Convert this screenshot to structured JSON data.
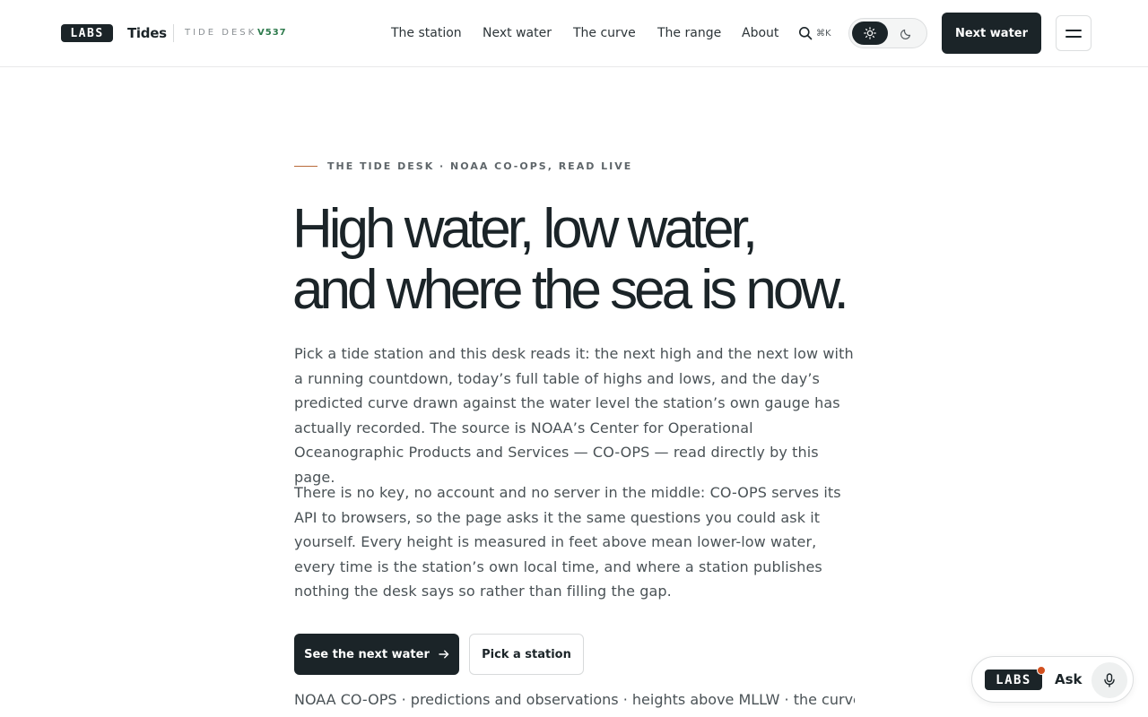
{
  "header": {
    "logo": "LABS",
    "brand": "Tides",
    "desk_label": "TIDE DESK",
    "version": "V537",
    "nav": [
      "The station",
      "Next water",
      "The curve",
      "The range",
      "About"
    ],
    "search_shortcut": "⌘K",
    "cta": "Next water"
  },
  "hero": {
    "eyebrow": "THE TIDE DESK · NOAA CO-OPS, READ LIVE",
    "title_line1": "High water, low water,",
    "title_line2": "and where the sea is now.",
    "para1": "Pick a tide station and this desk reads it: the next high and the next low with a running countdown, today’s full table of highs and lows, and the day’s predicted curve drawn against the water level the station’s own gauge has actually recorded. The source is NOAA’s Center for Operational Oceanographic Products and Services — CO-OPS — read directly by this page.",
    "para2": "There is no key, no account and no server in the middle: CO-OPS serves its API to browsers, so the page asks it the same questions you could ask it yourself. Every height is measured in feet above mean lower-low water, every time is the station’s own local time, and where a station publishes nothing the desk says so rather than filling the gap.",
    "primary_button": "See the next water",
    "secondary_button": "Pick a station",
    "footnote": "NOAA CO-OPS · predictions and observations · heights above MLLW · the curve"
  },
  "ask_widget": {
    "logo": "LABS",
    "label": "Ask"
  },
  "colors": {
    "ink": "#1b2428",
    "accent_rule": "#b96a3a",
    "version_green": "#2d7a4c",
    "notification_dot": "#d2501f"
  }
}
